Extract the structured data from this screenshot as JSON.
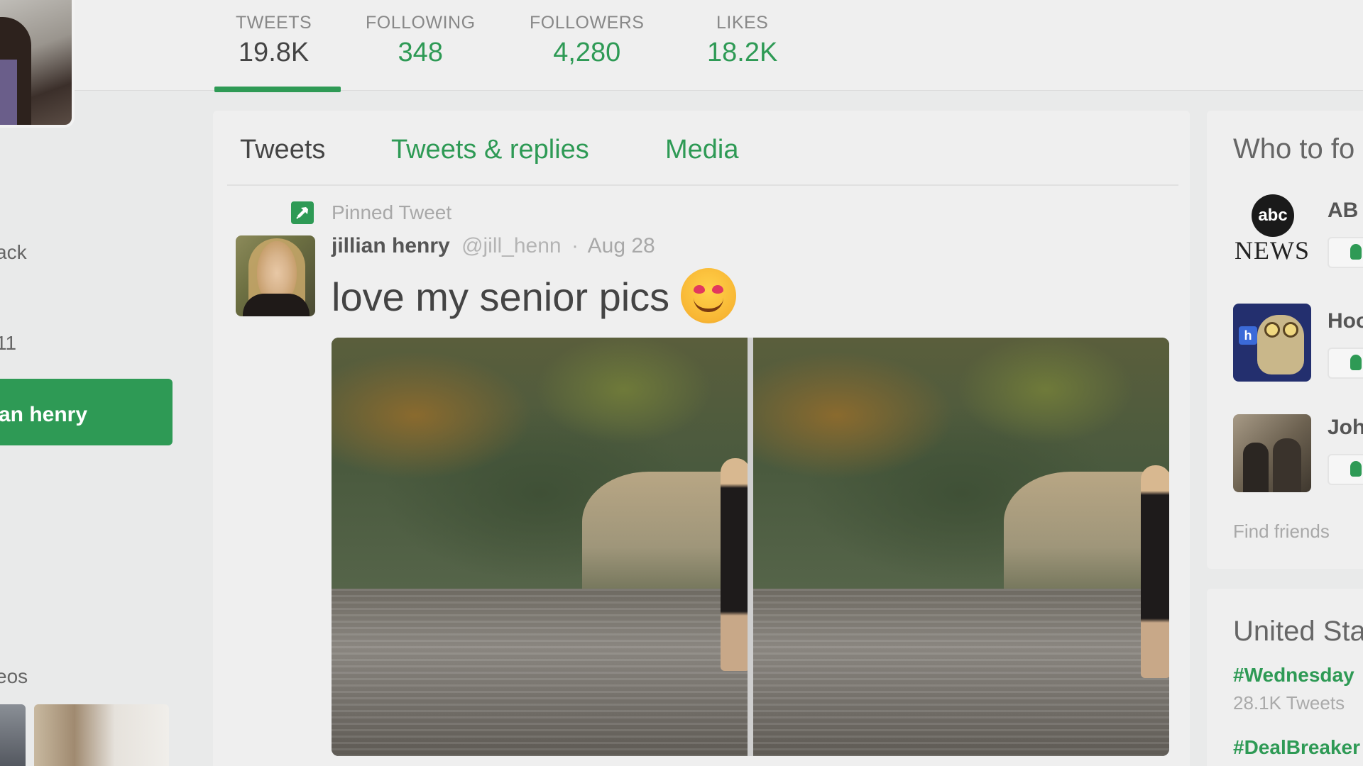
{
  "stats": [
    {
      "label": "TWEETS",
      "value": "19.8K"
    },
    {
      "label": "FOLLOWING",
      "value": "348"
    },
    {
      "label": "FOLLOWERS",
      "value": "4,280"
    },
    {
      "label": "LIKES",
      "value": "18.2K"
    }
  ],
  "left": {
    "fragment_back": "ack",
    "fragment_date": "11",
    "button_label": "an henry",
    "fragment_videos": "eos"
  },
  "tabs": [
    {
      "label": "Tweets",
      "active": true
    },
    {
      "label": "Tweets & replies",
      "active": false
    },
    {
      "label": "Media",
      "active": false
    }
  ],
  "tweet": {
    "pinned_label": "Pinned Tweet",
    "name": "jillian henry",
    "handle": "@jill_henn",
    "separator": "·",
    "date": "Aug 28",
    "text": "love my senior pics",
    "emoji": "smiling-face-heart-eyes"
  },
  "who_to_follow": {
    "title": "Who to fo",
    "accounts": [
      {
        "logo": "abc-news-logo",
        "logo_text_top": "abc",
        "logo_text_bottom": "NEWS",
        "name": "AB"
      },
      {
        "logo": "hootsuite-owl-logo",
        "name": "Hoo"
      },
      {
        "logo": "john-avatar",
        "name": "Joh"
      }
    ],
    "find_friends": "Find friends"
  },
  "trends": {
    "title": "United Sta",
    "items": [
      {
        "tag": "#Wednesday",
        "count": "28.1K Tweets"
      },
      {
        "tag": "#DealBreaker"
      }
    ]
  },
  "colors": {
    "accent": "#2e9a55",
    "background": "#e9eaea",
    "card": "#efefef"
  }
}
